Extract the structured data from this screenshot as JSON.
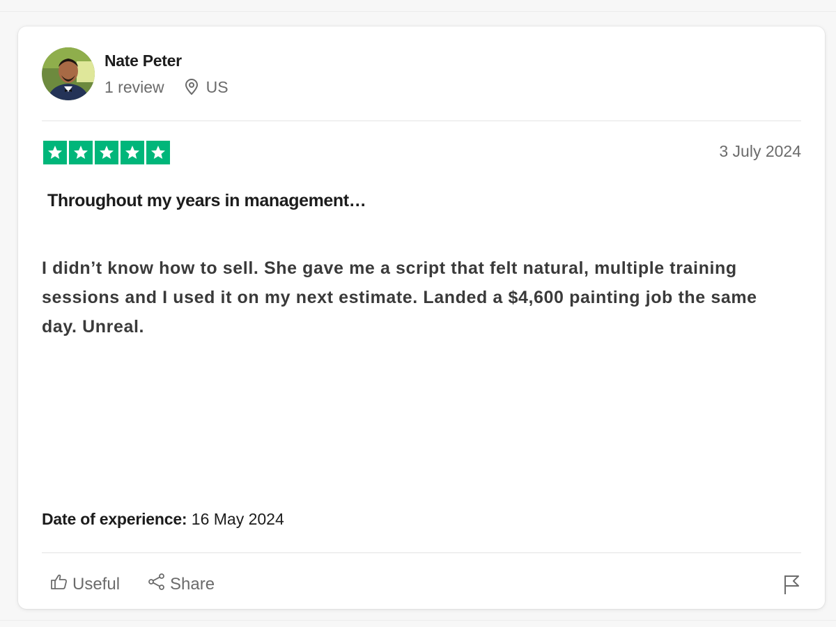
{
  "reviewer": {
    "name": "Nate Peter",
    "review_count": "1 review",
    "country": "US",
    "location_icon": "location-pin-icon"
  },
  "review": {
    "rating": 5,
    "rating_max": 5,
    "star_color": "#00b67a",
    "date": "3 July 2024",
    "title": "Throughout my years in management…",
    "body": "I didn’t know how to sell. She gave me a script that felt natural, multiple training sessions and I used it on my next estimate. Landed a $4,600 painting job the same day. Unreal.",
    "experience_label": "Date of experience:",
    "experience_date": " 16 May 2024"
  },
  "actions": {
    "useful_label": "Useful",
    "useful_icon": "thumbs-up-icon",
    "share_label": "Share",
    "share_icon": "share-icon",
    "report_icon": "flag-icon"
  }
}
